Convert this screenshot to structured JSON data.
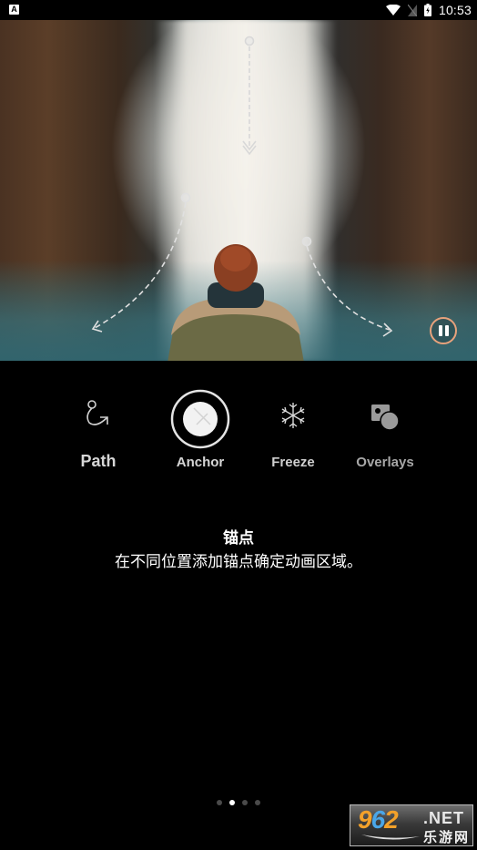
{
  "status_bar": {
    "notification_icon": "a-badge-icon",
    "notification_glyph": "A",
    "icons": [
      "wifi-icon",
      "no-sim-icon",
      "battery-charging-icon"
    ],
    "time": "10:53"
  },
  "hero": {
    "description": "Waterfall photo with person in fur-hood jacket; dashed motion path arrows",
    "motion_paths": [
      "down-arrow-path",
      "left-curve-path",
      "right-curve-path"
    ],
    "pause_button_icon": "pause-icon",
    "accent_color": "#e8a27c"
  },
  "tools": [
    {
      "id": "path",
      "label": "Path",
      "icon": "path-icon",
      "selected": false
    },
    {
      "id": "anchor",
      "label": "Anchor",
      "icon": "anchor-icon",
      "selected": true
    },
    {
      "id": "freeze",
      "label": "Freeze",
      "icon": "snowflake-icon",
      "selected": false
    },
    {
      "id": "overlays",
      "label": "Overlays",
      "icon": "overlays-icon",
      "selected": false
    }
  ],
  "description": {
    "title": "锚点",
    "body": "在不同位置添加锚点确定动画区域。"
  },
  "pagination": {
    "total": 4,
    "active_index": 1
  },
  "watermark": {
    "digit1": "9",
    "digit2": "6",
    "digit3": "2",
    "domain": ".NET",
    "cn": "乐游网"
  }
}
